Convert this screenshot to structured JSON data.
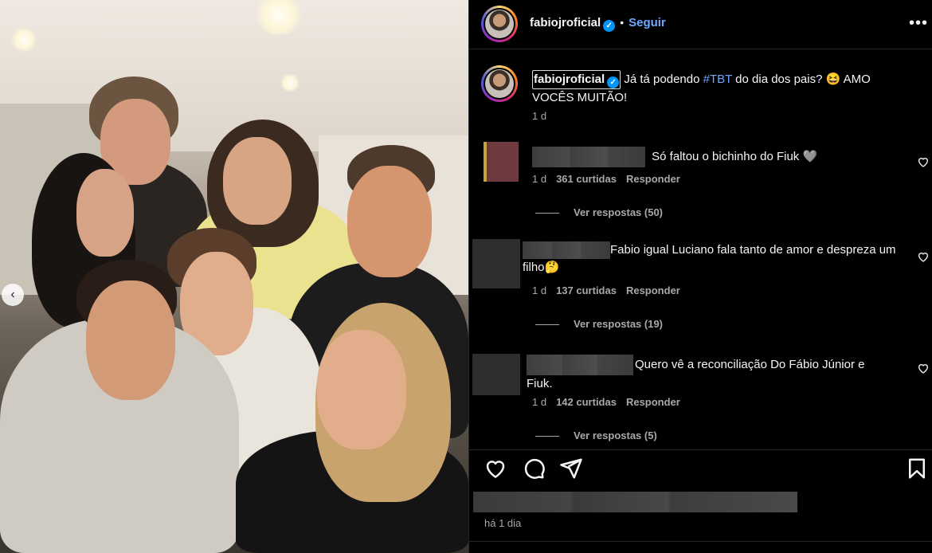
{
  "post": {
    "username": "fabiojroficial",
    "follow_label": "Seguir",
    "more_label": "•••",
    "verified_mark": "✓",
    "separator": "•",
    "caption": {
      "username": "fabiojroficial",
      "before_hashtag": " Já tá podendo ",
      "hashtag": "#TBT",
      "after_hashtag": " do dia dos pais? 😆 AMO VOCÊS MUITÃO!",
      "time": "1 d"
    },
    "comments": [
      {
        "text": "Só faltou o bichinho do Fiuk 🩶",
        "time": "1 d",
        "likes": "361 curtidas",
        "reply_label": "Responder",
        "view_replies": "Ver respostas (50)"
      },
      {
        "text": "Fabio igual Luciano fala tanto de amor e despreza um filho🤔",
        "time": "1 d",
        "likes": "137 curtidas",
        "reply_label": "Responder",
        "view_replies": "Ver respostas (19)"
      },
      {
        "text": "Quero vê a reconciliação Do Fábio Júnior e Fiuk.",
        "time": "1 d",
        "likes": "142 curtidas",
        "reply_label": "Responder",
        "view_replies": "Ver respostas (5)"
      }
    ],
    "actions": {
      "like_icon": "heart-icon",
      "comment_icon": "comment-icon",
      "share_icon": "share-icon",
      "save_icon": "bookmark-icon"
    },
    "date": "há 1 dia"
  },
  "photo": {
    "carousel_prev": "‹"
  },
  "colors": {
    "background": "#000000",
    "link_blue": "#6ea8ff",
    "verified_blue": "#0095f6",
    "muted_text": "#a8a8a8"
  }
}
